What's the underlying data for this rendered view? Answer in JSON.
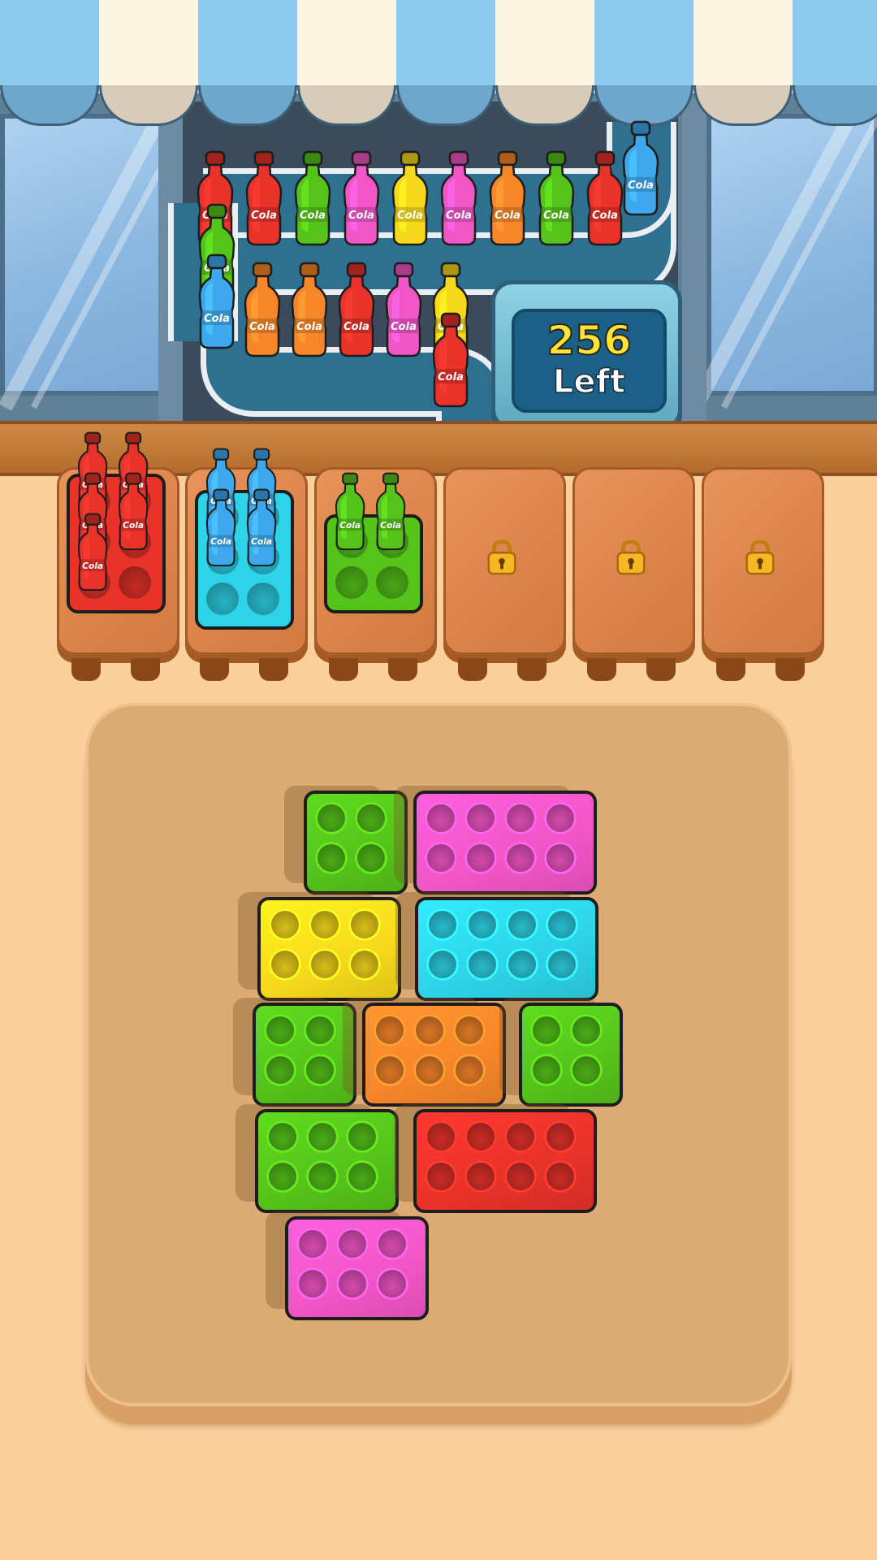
{
  "counter": {
    "number": "256",
    "label": "Left"
  },
  "bottle_label": "Cola",
  "colors": {
    "red": "#e8322a",
    "green": "#55c41a",
    "pink": "#f255c6",
    "yellow": "#f7d91c",
    "cyan": "#2dd3e8",
    "orange": "#f7862a",
    "blue": "#3ea8ee"
  },
  "conveyor": {
    "top_row": [
      "red",
      "red",
      "green",
      "pink",
      "yellow",
      "pink",
      "orange",
      "green",
      "red",
      "blue"
    ],
    "left_column": [
      "green",
      "blue"
    ],
    "bottom_row": [
      "orange",
      "orange",
      "red",
      "pink",
      "yellow"
    ],
    "exit": [
      "red"
    ]
  },
  "stools": [
    {
      "state": "tray",
      "tray_color": "red",
      "tray_cups": 6,
      "bottles": 5
    },
    {
      "state": "tray",
      "tray_color": "cyan",
      "tray_cups": 6,
      "bottles": 4
    },
    {
      "state": "tray",
      "tray_color": "green",
      "tray_cups": 4,
      "bottles": 2
    },
    {
      "state": "locked"
    },
    {
      "state": "locked"
    },
    {
      "state": "locked"
    }
  ],
  "board_blocks": [
    {
      "color": "green",
      "cols": 2,
      "rows": 2
    },
    {
      "color": "pink",
      "cols": 4,
      "rows": 2
    },
    {
      "color": "yellow",
      "cols": 3,
      "rows": 2
    },
    {
      "color": "cyan",
      "cols": 4,
      "rows": 2
    },
    {
      "color": "green",
      "cols": 2,
      "rows": 2
    },
    {
      "color": "orange",
      "cols": 3,
      "rows": 2
    },
    {
      "color": "green",
      "cols": 2,
      "rows": 2
    },
    {
      "color": "green",
      "cols": 3,
      "rows": 2
    },
    {
      "color": "red",
      "cols": 4,
      "rows": 2
    },
    {
      "color": "pink",
      "cols": 3,
      "rows": 2
    }
  ]
}
